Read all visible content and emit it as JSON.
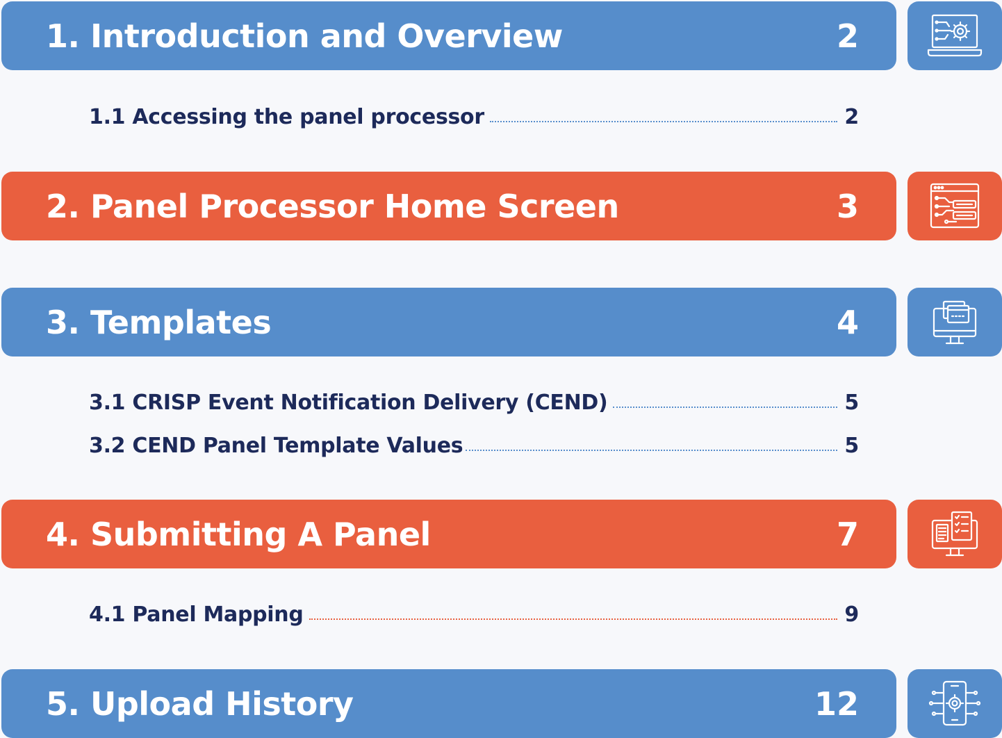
{
  "sections": [
    {
      "title": "1. Introduction and Overview",
      "page": "2",
      "icon": "laptop-gear-icon",
      "subsections": [
        {
          "label": "1.1 Accessing the panel processor",
          "page": "2"
        }
      ]
    },
    {
      "title": "2. Panel Processor Home Screen",
      "page": "3",
      "icon": "browser-circuit-icon",
      "subsections": []
    },
    {
      "title": "3. Templates",
      "page": "4",
      "icon": "monitor-windows-icon",
      "subsections": [
        {
          "label": "3.1 CRISP Event Notification Delivery (CEND)",
          "page": "5"
        },
        {
          "label": "3.2 CEND Panel Template Values",
          "page": "5"
        }
      ]
    },
    {
      "title": "4. Submitting A Panel",
      "page": "7",
      "icon": "monitor-checklist-icon",
      "subsections": [
        {
          "label": "4.1 Panel Mapping",
          "page": "9"
        }
      ]
    },
    {
      "title": "5. Upload History",
      "page": "12",
      "icon": "phone-circuit-gear-icon",
      "subsections": []
    }
  ],
  "colors": {
    "blue": "#568dcb",
    "orange": "#e95f3f",
    "navy_text": "#1d2a5a"
  }
}
